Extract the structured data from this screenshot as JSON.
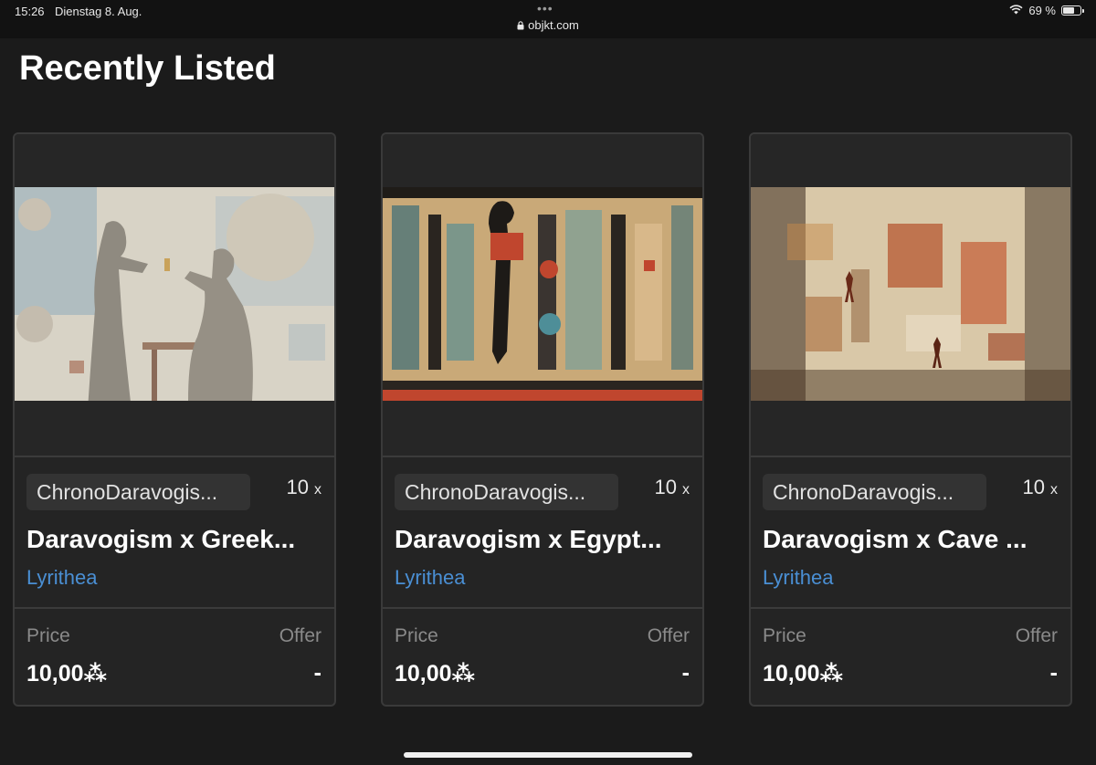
{
  "status_bar": {
    "time": "15:26",
    "date": "Dienstag 8. Aug.",
    "url": "objkt.com",
    "battery": "69 %",
    "battery_level": 0.69
  },
  "page": {
    "title": "Recently Listed"
  },
  "labels": {
    "price": "Price",
    "offer": "Offer",
    "edition_suffix": "x"
  },
  "colors": {
    "background": "#1b1b1b",
    "card": "#242424",
    "artist_link": "#4a8fd4"
  },
  "cards": [
    {
      "collection": "ChronoDaravogis...",
      "editions": "10",
      "title": "Daravogism x Greek...",
      "artist": "Lyrithea",
      "price": "10,00⁂",
      "offer": "-"
    },
    {
      "collection": "ChronoDaravogis...",
      "editions": "10",
      "title": "Daravogism x Egypt...",
      "artist": "Lyrithea",
      "price": "10,00⁂",
      "offer": "-"
    },
    {
      "collection": "ChronoDaravogis...",
      "editions": "10",
      "title": "Daravogism x Cave ...",
      "artist": "Lyrithea",
      "price": "10,00⁂",
      "offer": "-"
    }
  ]
}
